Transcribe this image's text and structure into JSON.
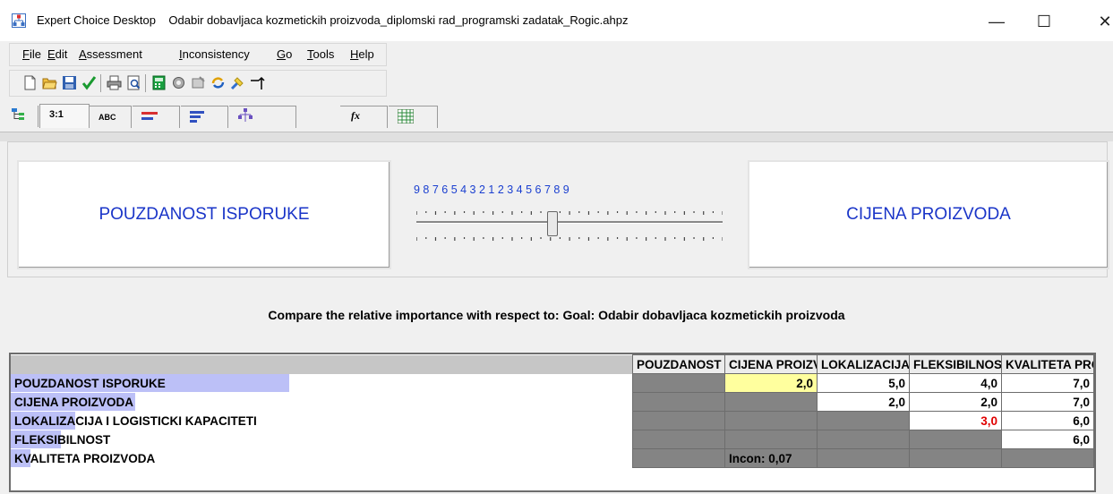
{
  "window": {
    "app_name": "Expert Choice Desktop",
    "file_title": "Odabir dobavljaca kozmetickih proizvoda_diplomski rad_programski zadatak_Rogic.ahpz",
    "minimize": "—",
    "maximize": "☐",
    "close": "✕"
  },
  "menu": {
    "items": [
      {
        "u": "F",
        "rest": "ile"
      },
      {
        "u": "E",
        "rest": "dit"
      },
      {
        "u": "A",
        "rest": "ssessment"
      },
      {
        "u": "I",
        "rest": "nconsistency"
      },
      {
        "u": "G",
        "rest": "o"
      },
      {
        "u": "T",
        "rest": "ools"
      },
      {
        "u": "H",
        "rest": "elp"
      }
    ]
  },
  "toolbar_icons": [
    "new-icon",
    "open-icon",
    "save-icon",
    "check-icon",
    "print-icon",
    "print-preview-icon",
    "calculator-icon",
    "gear-icon",
    "paint-icon",
    "refresh-icon",
    "clean-icon",
    "arrow-up-icon"
  ],
  "tabs": {
    "t1": "",
    "t2": "3:1",
    "t3": "ABC",
    "t4": "",
    "t5": "",
    "t6": "",
    "t7": "fx",
    "t8": ""
  },
  "compare": {
    "left": "POUZDANOST ISPORUKE",
    "right": "CIJENA PROIZVODA",
    "scale": "9 8 7 6 5 4 3 2 1 2 3 4 5 6 7 8 9",
    "slider_value": 2
  },
  "question": "Compare the relative importance with respect to: Goal: Odabir dobavljaca kozmetickih proizvoda",
  "matrix": {
    "columns": [
      "POUZDANOST ISPORUKE",
      "CIJENA PROIZVODA",
      "LOKALIZACIJA I LOGISTICKI KAPACITETI",
      "FLEKSIBILNOST",
      "KVALITETA PROIZVODA"
    ],
    "rows": [
      {
        "label": "POUZDANOST ISPORUKE",
        "c2": "2,0",
        "c3": "5,0",
        "c4": "4,0",
        "c5": "7,0"
      },
      {
        "label": "CIJENA PROIZVODA",
        "c3": "2,0",
        "c4": "2,0",
        "c5": "7,0"
      },
      {
        "label": "LOKALIZACIJA I LOGISTICKI KAPACITETI",
        "c4": "3,0",
        "c5": "6,0"
      },
      {
        "label": "FLEKSIBILNOST",
        "c5": "6,0"
      },
      {
        "label": "KVALITETA PROIZVODA"
      }
    ],
    "inconsistency": "Incon: 0,07",
    "priority_bars": [
      0.56,
      0.25,
      0.13,
      0.1,
      0.04
    ]
  },
  "colors": {
    "element_text": "#1a35c8",
    "highlight_cell": "#ffff9e",
    "inverse_value": "#e00000",
    "priority_bar": "#bcc0f7"
  }
}
